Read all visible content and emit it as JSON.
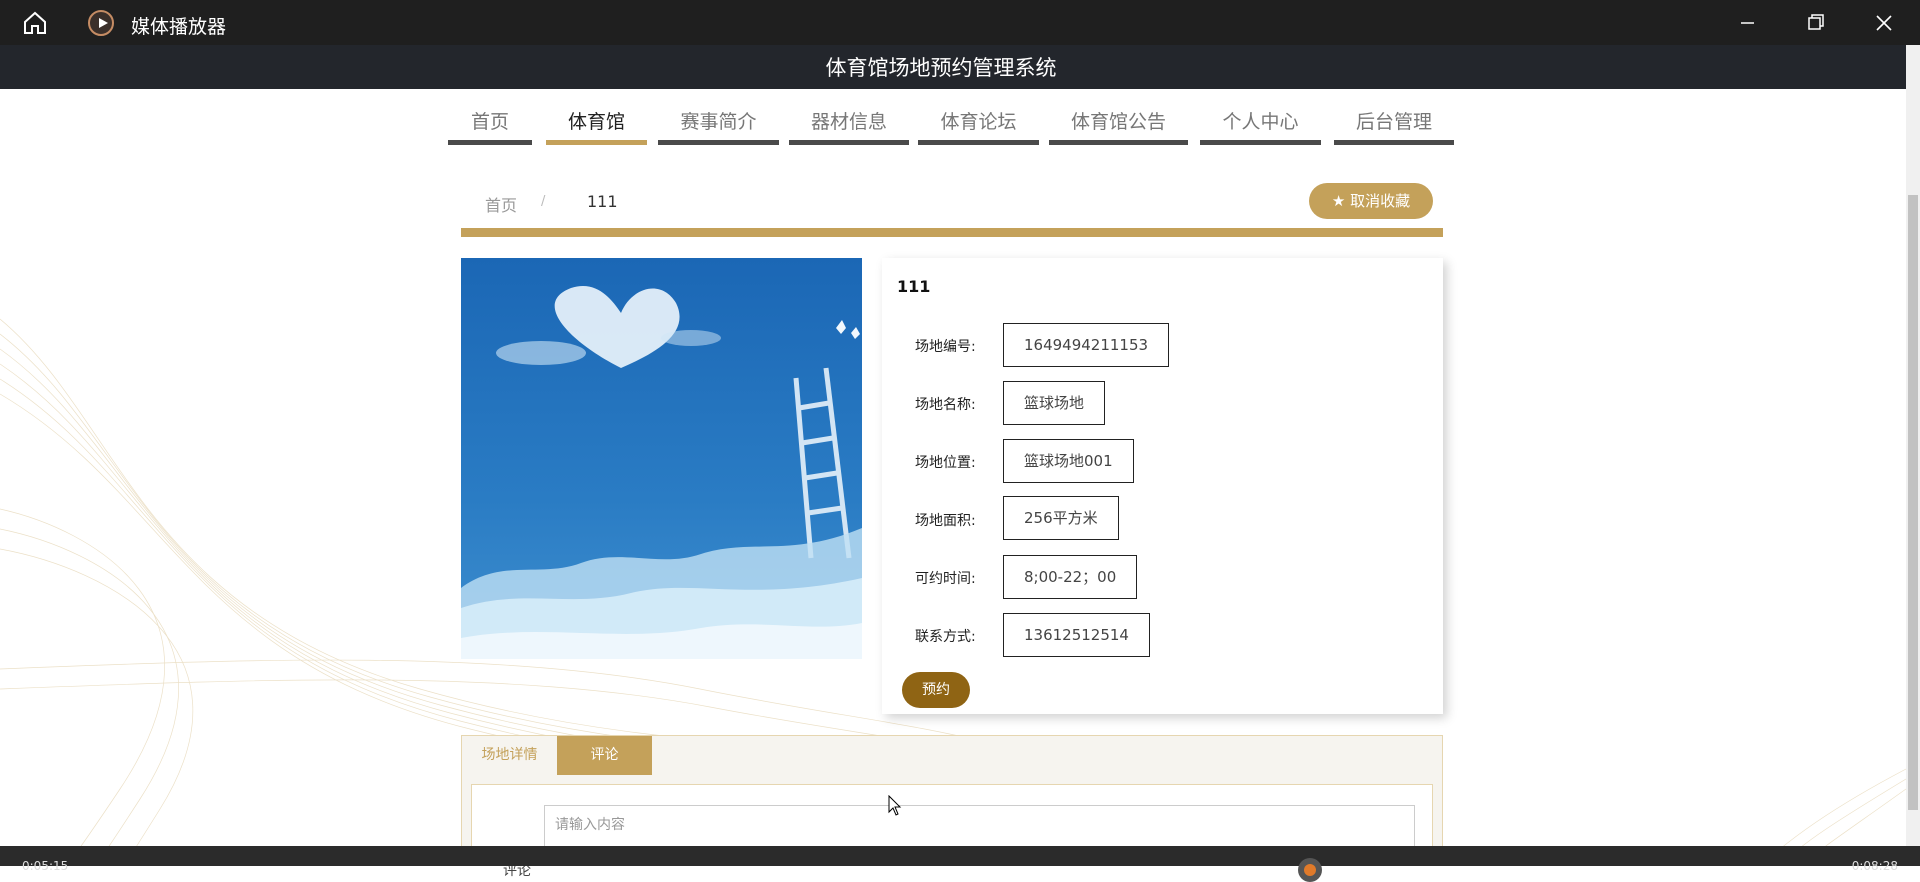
{
  "player": {
    "title": "媒体播放器",
    "time_left": "0:05:15",
    "time_right": "0:08:28"
  },
  "site": {
    "title": "体育馆场地预约管理系统"
  },
  "nav": {
    "items": [
      {
        "label": "首页"
      },
      {
        "label": "体育馆"
      },
      {
        "label": "赛事简介"
      },
      {
        "label": "器材信息"
      },
      {
        "label": "体育论坛"
      },
      {
        "label": "体育馆公告"
      },
      {
        "label": "个人中心"
      },
      {
        "label": "后台管理"
      }
    ],
    "active": "体育馆"
  },
  "breadcrumb": {
    "home": "首页",
    "sep": "/",
    "current": "111"
  },
  "favorite_button": "★ 取消收藏",
  "venue": {
    "name": "111",
    "fields": [
      {
        "label": "场地编号:",
        "value": "1649494211153"
      },
      {
        "label": "场地名称:",
        "value": "篮球场地"
      },
      {
        "label": "场地位置:",
        "value": "篮球场地001"
      },
      {
        "label": "场地面积:",
        "value": "256平方米"
      },
      {
        "label": "可约时间:",
        "value": "8;00-22；00"
      },
      {
        "label": "联系方式:",
        "value": "13612512514"
      }
    ],
    "book_label": "预约"
  },
  "tabs": {
    "detail": "场地详情",
    "comment": "评论"
  },
  "comment": {
    "placeholder": "请输入内容",
    "label": "评论"
  },
  "colors": {
    "accent": "#c4a15a",
    "header_bg": "#23262c",
    "book_btn": "#8f6414"
  }
}
